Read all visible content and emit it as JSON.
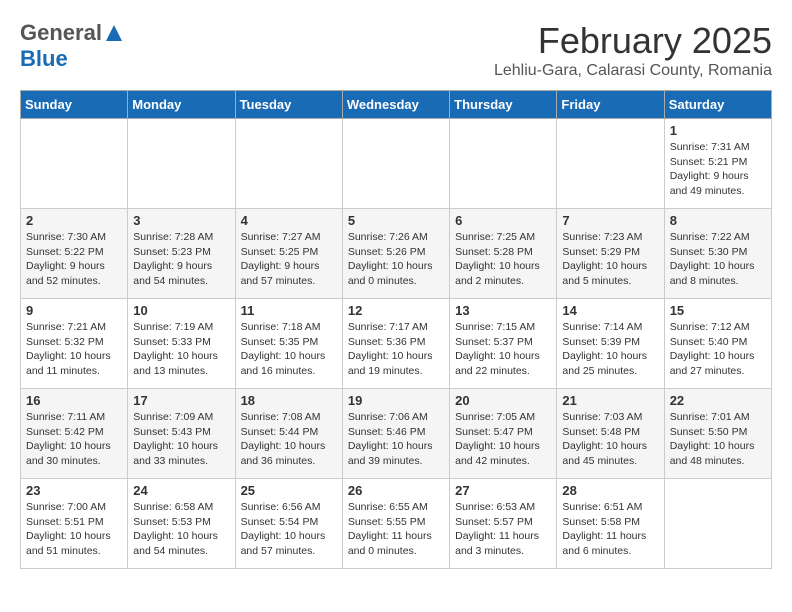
{
  "header": {
    "logo_general": "General",
    "logo_blue": "Blue",
    "month": "February 2025",
    "location": "Lehliu-Gara, Calarasi County, Romania"
  },
  "days_of_week": [
    "Sunday",
    "Monday",
    "Tuesday",
    "Wednesday",
    "Thursday",
    "Friday",
    "Saturday"
  ],
  "weeks": [
    [
      {
        "day": "",
        "info": ""
      },
      {
        "day": "",
        "info": ""
      },
      {
        "day": "",
        "info": ""
      },
      {
        "day": "",
        "info": ""
      },
      {
        "day": "",
        "info": ""
      },
      {
        "day": "",
        "info": ""
      },
      {
        "day": "1",
        "info": "Sunrise: 7:31 AM\nSunset: 5:21 PM\nDaylight: 9 hours and 49 minutes."
      }
    ],
    [
      {
        "day": "2",
        "info": "Sunrise: 7:30 AM\nSunset: 5:22 PM\nDaylight: 9 hours and 52 minutes."
      },
      {
        "day": "3",
        "info": "Sunrise: 7:28 AM\nSunset: 5:23 PM\nDaylight: 9 hours and 54 minutes."
      },
      {
        "day": "4",
        "info": "Sunrise: 7:27 AM\nSunset: 5:25 PM\nDaylight: 9 hours and 57 minutes."
      },
      {
        "day": "5",
        "info": "Sunrise: 7:26 AM\nSunset: 5:26 PM\nDaylight: 10 hours and 0 minutes."
      },
      {
        "day": "6",
        "info": "Sunrise: 7:25 AM\nSunset: 5:28 PM\nDaylight: 10 hours and 2 minutes."
      },
      {
        "day": "7",
        "info": "Sunrise: 7:23 AM\nSunset: 5:29 PM\nDaylight: 10 hours and 5 minutes."
      },
      {
        "day": "8",
        "info": "Sunrise: 7:22 AM\nSunset: 5:30 PM\nDaylight: 10 hours and 8 minutes."
      }
    ],
    [
      {
        "day": "9",
        "info": "Sunrise: 7:21 AM\nSunset: 5:32 PM\nDaylight: 10 hours and 11 minutes."
      },
      {
        "day": "10",
        "info": "Sunrise: 7:19 AM\nSunset: 5:33 PM\nDaylight: 10 hours and 13 minutes."
      },
      {
        "day": "11",
        "info": "Sunrise: 7:18 AM\nSunset: 5:35 PM\nDaylight: 10 hours and 16 minutes."
      },
      {
        "day": "12",
        "info": "Sunrise: 7:17 AM\nSunset: 5:36 PM\nDaylight: 10 hours and 19 minutes."
      },
      {
        "day": "13",
        "info": "Sunrise: 7:15 AM\nSunset: 5:37 PM\nDaylight: 10 hours and 22 minutes."
      },
      {
        "day": "14",
        "info": "Sunrise: 7:14 AM\nSunset: 5:39 PM\nDaylight: 10 hours and 25 minutes."
      },
      {
        "day": "15",
        "info": "Sunrise: 7:12 AM\nSunset: 5:40 PM\nDaylight: 10 hours and 27 minutes."
      }
    ],
    [
      {
        "day": "16",
        "info": "Sunrise: 7:11 AM\nSunset: 5:42 PM\nDaylight: 10 hours and 30 minutes."
      },
      {
        "day": "17",
        "info": "Sunrise: 7:09 AM\nSunset: 5:43 PM\nDaylight: 10 hours and 33 minutes."
      },
      {
        "day": "18",
        "info": "Sunrise: 7:08 AM\nSunset: 5:44 PM\nDaylight: 10 hours and 36 minutes."
      },
      {
        "day": "19",
        "info": "Sunrise: 7:06 AM\nSunset: 5:46 PM\nDaylight: 10 hours and 39 minutes."
      },
      {
        "day": "20",
        "info": "Sunrise: 7:05 AM\nSunset: 5:47 PM\nDaylight: 10 hours and 42 minutes."
      },
      {
        "day": "21",
        "info": "Sunrise: 7:03 AM\nSunset: 5:48 PM\nDaylight: 10 hours and 45 minutes."
      },
      {
        "day": "22",
        "info": "Sunrise: 7:01 AM\nSunset: 5:50 PM\nDaylight: 10 hours and 48 minutes."
      }
    ],
    [
      {
        "day": "23",
        "info": "Sunrise: 7:00 AM\nSunset: 5:51 PM\nDaylight: 10 hours and 51 minutes."
      },
      {
        "day": "24",
        "info": "Sunrise: 6:58 AM\nSunset: 5:53 PM\nDaylight: 10 hours and 54 minutes."
      },
      {
        "day": "25",
        "info": "Sunrise: 6:56 AM\nSunset: 5:54 PM\nDaylight: 10 hours and 57 minutes."
      },
      {
        "day": "26",
        "info": "Sunrise: 6:55 AM\nSunset: 5:55 PM\nDaylight: 11 hours and 0 minutes."
      },
      {
        "day": "27",
        "info": "Sunrise: 6:53 AM\nSunset: 5:57 PM\nDaylight: 11 hours and 3 minutes."
      },
      {
        "day": "28",
        "info": "Sunrise: 6:51 AM\nSunset: 5:58 PM\nDaylight: 11 hours and 6 minutes."
      },
      {
        "day": "",
        "info": ""
      }
    ]
  ]
}
